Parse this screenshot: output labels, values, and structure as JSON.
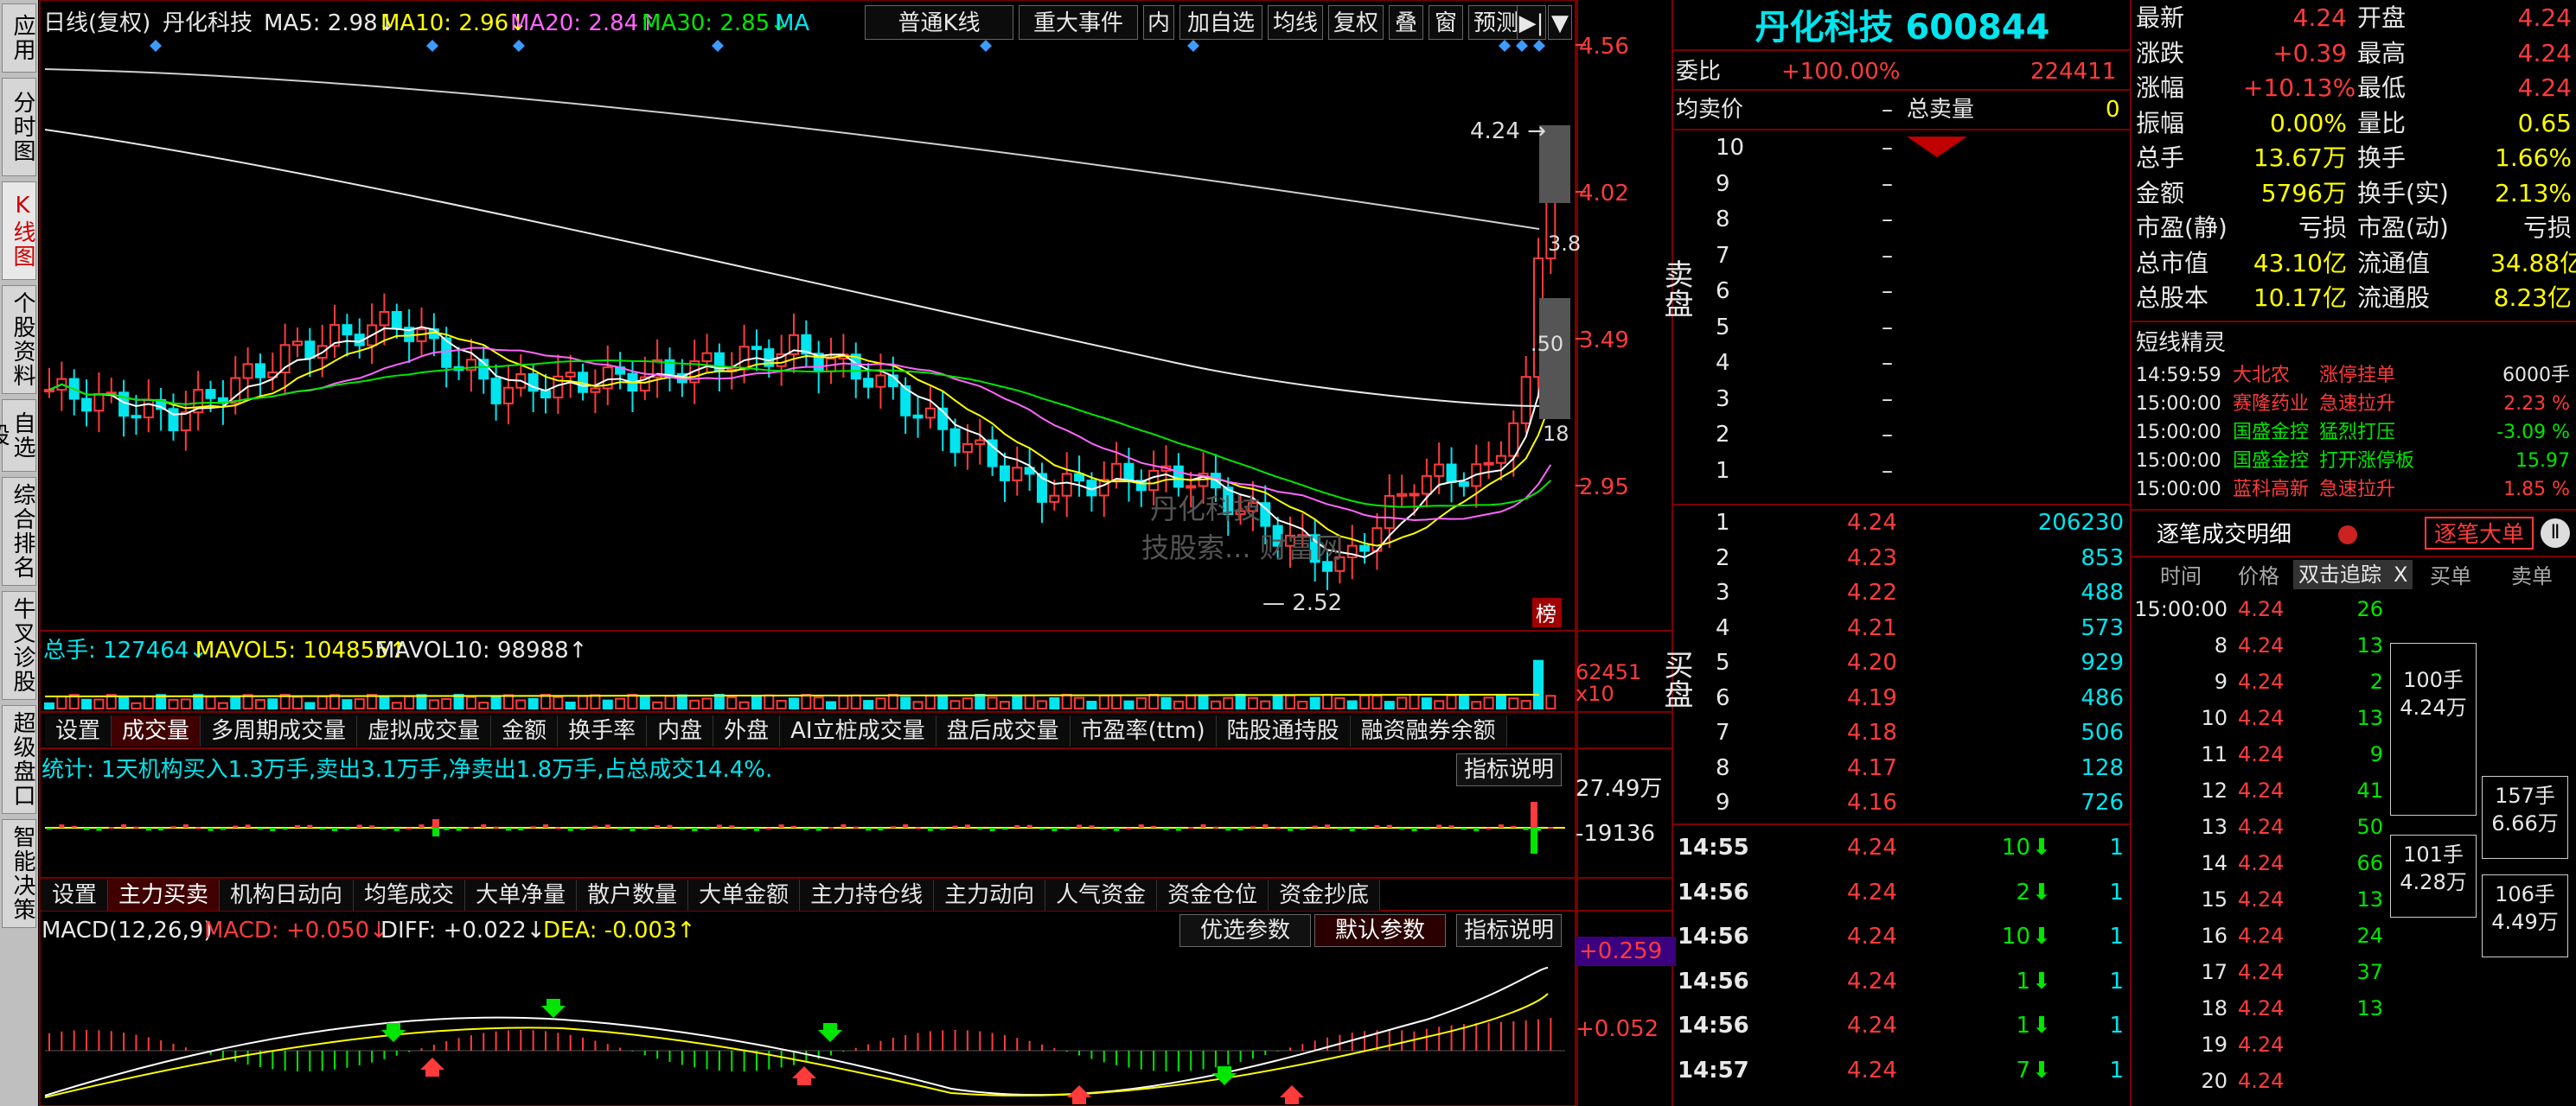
{
  "nav": [
    "应用",
    "分时图",
    "K线图",
    "个股资料",
    "自选股",
    "综合排名",
    "牛叉诊股",
    "超级盘口",
    "智能决策"
  ],
  "nav_active": 2,
  "kline_header": {
    "prefix": "日线(复权)",
    "name": "丹化科技",
    "ma5": "MA5: 2.98↓",
    "ma10": "MA10: 2.96↓",
    "ma20": "MA20: 2.84↑",
    "ma30": "MA30: 2.85↓",
    "ma": "MA"
  },
  "toolbar": [
    "普通K线",
    "重大事件",
    "内",
    "加自选",
    "均线",
    "复权",
    "叠",
    "窗",
    "预测"
  ],
  "price_axis": [
    "4.56",
    "4.02",
    "3.49",
    "2.95"
  ],
  "annotations": {
    "high": "4.24",
    "low": "2.52",
    "r1": "3.8",
    "r2": ".50",
    "r3": "18"
  },
  "bang": "榜",
  "watermark": [
    "丹化科技",
    "技股索...",
    "财富网"
  ],
  "volume": {
    "total": "总手: 127464↓",
    "mavol5": "MAVOL5: 104855↑",
    "mavol10": "MAVOL10: 98988↑",
    "axis_top": "62451",
    "axis_bottom": "x10"
  },
  "tabs1": [
    "设置",
    "成交量",
    "多周期成交量",
    "虚拟成交量",
    "金额",
    "换手率",
    "内盘",
    "外盘",
    "AI立桩成交量",
    "盘后成交量",
    "市盈率(ttm)",
    "陆股通持股",
    "融资融券余额"
  ],
  "tabs1_active": 1,
  "inst": {
    "text": "统计: 1天机构买入1.3万手,卖出3.1万手,净卖出1.8万手,占总成交14.4%.",
    "explain": "指标说明",
    "axis_top": "27.49万",
    "axis_mid": "-19136"
  },
  "tabs2": [
    "设置",
    "主力买卖",
    "机构日动向",
    "均笔成交",
    "大单净量",
    "散户数量",
    "大单金额",
    "主力持仓线",
    "主力动向",
    "人气资金",
    "资金仓位",
    "资金抄底"
  ],
  "tabs2_active": 1,
  "macd": {
    "label": "MACD(12,26,9)",
    "macd": "MACD: +0.050↓",
    "diff": "DIFF: +0.022↓",
    "dea": "DEA: -0.003↑",
    "opt1": "优选参数",
    "opt2": "默认参数",
    "explain": "指标说明",
    "axis_top": "+0.259",
    "axis_mid": "+0.052"
  },
  "stock": {
    "title": "丹化科技 600844"
  },
  "orderbook": {
    "weibi_label": "委比",
    "weibi": "+100.00%",
    "weibi_num": "224411",
    "avg_label": "均卖价",
    "avg_val": "–",
    "total_label": "总卖量",
    "total_val": "0",
    "sell_label": "卖盘",
    "buy_label": "买盘",
    "sells": [
      [
        "10",
        "–"
      ],
      [
        "9",
        "–"
      ],
      [
        "8",
        "–"
      ],
      [
        "7",
        "–"
      ],
      [
        "6",
        "–"
      ],
      [
        "5",
        "–"
      ],
      [
        "4",
        "–"
      ],
      [
        "3",
        "–"
      ],
      [
        "2",
        "–"
      ],
      [
        "1",
        "–"
      ]
    ],
    "buys": [
      [
        "1",
        "4.24",
        "206230"
      ],
      [
        "2",
        "4.23",
        "853"
      ],
      [
        "3",
        "4.22",
        "488"
      ],
      [
        "4",
        "4.21",
        "573"
      ],
      [
        "5",
        "4.20",
        "929"
      ],
      [
        "6",
        "4.19",
        "486"
      ],
      [
        "7",
        "4.18",
        "506"
      ],
      [
        "8",
        "4.17",
        "128"
      ],
      [
        "9",
        "4.16",
        "726"
      ]
    ]
  },
  "ticks": [
    [
      "14:55",
      "4.24",
      "10",
      "1"
    ],
    [
      "14:56",
      "4.24",
      "2",
      "1"
    ],
    [
      "14:56",
      "4.24",
      "10",
      "1"
    ],
    [
      "14:56",
      "4.24",
      "1",
      "1"
    ],
    [
      "14:56",
      "4.24",
      "1",
      "1"
    ],
    [
      "14:57",
      "4.24",
      "7",
      "1"
    ]
  ],
  "quote": [
    [
      "最新",
      "4.24",
      "开盘",
      "4.24"
    ],
    [
      "涨跌",
      "+0.39",
      "最高",
      "4.24"
    ],
    [
      "涨幅",
      "+10.13%",
      "最低",
      "4.24"
    ],
    [
      "振幅",
      "0.00%",
      "量比",
      "0.65"
    ],
    [
      "总手",
      "13.67万",
      "换手",
      "1.66%"
    ],
    [
      "金额",
      "5796万",
      "换手(实)",
      "2.13%"
    ],
    [
      "市盈(静)",
      "亏损",
      "市盈(动)",
      "亏损"
    ],
    [
      "总市值",
      "43.10亿",
      "流通值",
      "34.88亿"
    ],
    [
      "总股本",
      "10.17亿",
      "流通股",
      "8.23亿"
    ]
  ],
  "wizard": {
    "title": "短线精灵",
    "rows": [
      [
        "14:59:59",
        "大北农",
        "涨停挂单",
        "6000手"
      ],
      [
        "15:00:00",
        "赛隆药业",
        "急速拉升",
        "2.23 %"
      ],
      [
        "15:00:00",
        "国盛金控",
        "猛烈打压",
        "-3.09 %"
      ],
      [
        "15:00:00",
        "国盛金控",
        "打开涨停板",
        "15.97"
      ],
      [
        "15:00:00",
        "蓝科高新",
        "急速拉升",
        "1.85 %"
      ]
    ]
  },
  "detail": {
    "title": "逐笔成交明细",
    "big_btn": "逐笔大单",
    "track": "双击追踪",
    "close": "X",
    "headers": [
      "时间",
      "价格",
      "买单",
      "卖单"
    ],
    "rows": [
      [
        "15:00:00",
        "4.24",
        "26"
      ],
      [
        "8",
        "4.24",
        "13"
      ],
      [
        "9",
        "4.24",
        "2"
      ],
      [
        "10",
        "4.24",
        "13"
      ],
      [
        "11",
        "4.24",
        "9"
      ],
      [
        "12",
        "4.24",
        "41"
      ],
      [
        "13",
        "4.24",
        "50"
      ],
      [
        "14",
        "4.24",
        "66"
      ],
      [
        "15",
        "4.24",
        "13"
      ],
      [
        "16",
        "4.24",
        "24"
      ],
      [
        "17",
        "4.24",
        "37"
      ],
      [
        "18",
        "4.24",
        "13"
      ],
      [
        "19",
        "4.24",
        ""
      ],
      [
        "20",
        "4.24",
        ""
      ]
    ],
    "boxes": [
      [
        "100手",
        "4.24万"
      ],
      [
        "157手",
        "6.66万"
      ],
      [
        "101手",
        "4.28万"
      ],
      [
        "106手",
        "4.49万"
      ]
    ]
  },
  "colors": {
    "up": "#ff3b3b",
    "down": "#00e5ee",
    "ma5": "#ffffff",
    "ma10": "#ffff00",
    "ma20": "#ff66ff",
    "ma30": "#00e600",
    "frame": "#7a0000"
  }
}
